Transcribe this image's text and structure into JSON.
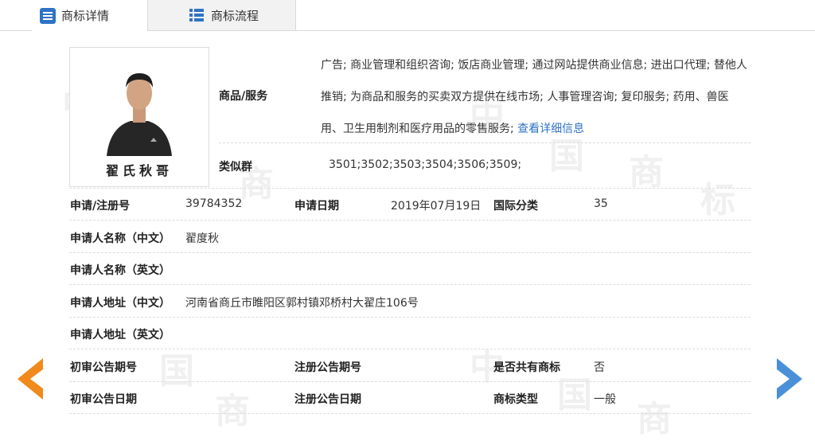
{
  "tabs": [
    {
      "label": "商标详情",
      "active": true,
      "icon": "list-detail-icon"
    },
    {
      "label": "商标流程",
      "active": false,
      "icon": "list-flow-icon"
    }
  ],
  "watermark_text": "中国商标",
  "trademark": {
    "image_text": "翟氏秋哥",
    "goods_label": "商品/服务",
    "goods_text": "广告; 商业管理和组织咨询; 饭店商业管理; 通过网站提供商业信息; 进出口代理; 替他人推销; 为商品和服务的买卖双方提供在线市场; 人事管理咨询; 复印服务; 药用、兽医用、卫生用制剂和医疗用品的零售服务;",
    "goods_link": "查看详细信息",
    "similar_label": "类似群",
    "similar_value": "3501;3502;3503;3504;3506;3509;"
  },
  "fields": {
    "reg_no_label": "申请/注册号",
    "reg_no": "39784352",
    "app_date_label": "申请日期",
    "app_date": "2019年07月19日",
    "intl_class_label": "国际分类",
    "intl_class": "35",
    "applicant_cn_label": "申请人名称（中文）",
    "applicant_cn": "翟度秋",
    "applicant_en_label": "申请人名称（英文）",
    "applicant_en": "",
    "address_cn_label": "申请人地址（中文）",
    "address_cn": "河南省商丘市睢阳区郭村镇邓桥村大翟庄106号",
    "address_en_label": "申请人地址（英文）",
    "address_en": "",
    "prelim_no_label": "初审公告期号",
    "prelim_no": "",
    "reg_notice_no_label": "注册公告期号",
    "reg_notice_no": "",
    "shared_label": "是否共有商标",
    "shared": "否",
    "prelim_date_label": "初审公告日期",
    "prelim_date": "",
    "reg_notice_date_label": "注册公告日期",
    "reg_notice_date": "",
    "type_label": "商标类型",
    "type": "一般"
  },
  "colors": {
    "accent": "#2f73c4",
    "arrow_left": "#f08a1c",
    "arrow_right": "#4a90d9"
  }
}
